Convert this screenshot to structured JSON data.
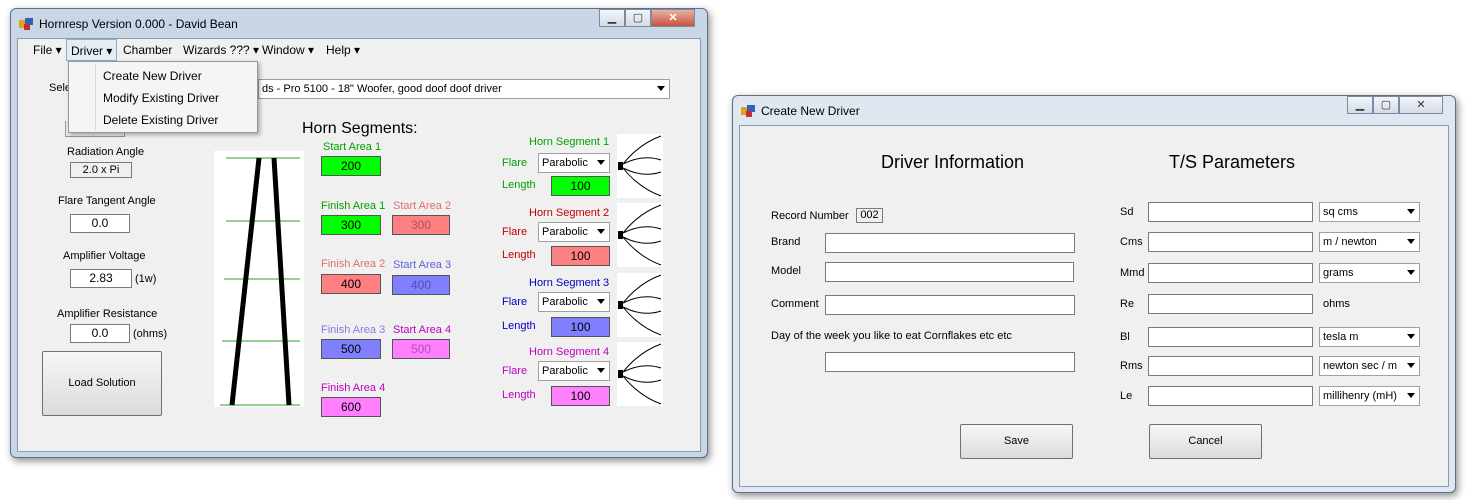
{
  "main_window": {
    "title": "Hornresp Version 0.000 - David Bean",
    "menu": [
      "File",
      "Driver",
      "Chamber",
      "Wizards ???",
      "Window",
      "Help"
    ],
    "driver_menu_items": [
      "Create New Driver",
      "Modify Existing Driver",
      "Delete Existing Driver"
    ],
    "select_label": "Sele",
    "selected_driver": "ds - Pro 5100 - 18\" Woofer, good doof doof driver",
    "radiation_angle_label": "Radiation Angle",
    "radiation_angle_value": "2.0 x Pi",
    "flare_tangent_label": "Flare Tangent Angle",
    "flare_tangent_value": "0.0",
    "amp_voltage_label": "Amplifier Voltage",
    "amp_voltage_value": "2.83",
    "amp_voltage_unit": "(1w)",
    "amp_resistance_label": "Amplifier Resistance",
    "amp_resistance_value": "0.0",
    "amp_resistance_unit": "(ohms)",
    "load_button": "Load Solution",
    "horn_segments_title": "Horn Segments:",
    "areas": {
      "start_area_1": "Start Area 1",
      "start_area_1_value": "200",
      "finish_area_1": "Finish Area 1",
      "finish_area_1_value": "300",
      "start_area_2": "Start Area 2",
      "start_area_2_value": "300",
      "finish_area_2": "Finish Area 2",
      "finish_area_2_value": "400",
      "start_area_3": "Start Area 3",
      "start_area_3_value": "400",
      "finish_area_3": "Finish Area 3",
      "finish_area_3_value": "500",
      "start_area_4": "Start Area 4",
      "start_area_4_value": "500",
      "finish_area_4": "Finish Area 4",
      "finish_area_4_value": "600"
    },
    "segments": [
      {
        "title": "Horn Segment 1",
        "flare_label": "Flare",
        "flare": "Parabolic",
        "length_label": "Length",
        "length": "100"
      },
      {
        "title": "Horn Segment 2",
        "flare_label": "Flare",
        "flare": "Parabolic",
        "length_label": "Length",
        "length": "100"
      },
      {
        "title": "Horn Segment 3",
        "flare_label": "Flare",
        "flare": "Parabolic",
        "length_label": "Length",
        "length": "100"
      },
      {
        "title": "Horn Segment 4",
        "flare_label": "Flare",
        "flare": "Parabolic",
        "length_label": "Length",
        "length": "100"
      }
    ]
  },
  "driver_window": {
    "title": "Create New Driver",
    "driver_info_title": "Driver Information",
    "ts_title": "T/S Parameters",
    "record_number_label": "Record Number",
    "record_number": "002",
    "brand_label": "Brand",
    "model_label": "Model",
    "comment_label": "Comment",
    "day_label": "Day of the week you like to eat Cornflakes etc etc",
    "params": [
      {
        "label": "Sd",
        "unit": "sq cms"
      },
      {
        "label": "Cms",
        "unit": "m / newton"
      },
      {
        "label": "Mmd",
        "unit": "grams"
      },
      {
        "label": "Re",
        "unit": "ohms"
      },
      {
        "label": "Bl",
        "unit": "tesla m"
      },
      {
        "label": "Rms",
        "unit": "newton sec / m"
      },
      {
        "label": "Le",
        "unit": "millihenry (mH)"
      }
    ],
    "save_button": "Save",
    "cancel_button": "Cancel"
  },
  "colors": {
    "green": "#00ff00",
    "green_text": "#00a000",
    "red_box": "#ff8080",
    "red_text": "#d04040",
    "dark_red_text": "#c00000",
    "blue_box": "#8080ff",
    "blue_text": "#6060e0",
    "dark_blue_text": "#0000c0",
    "pink_box": "#ff80ff",
    "pink_text": "#c000c0"
  }
}
